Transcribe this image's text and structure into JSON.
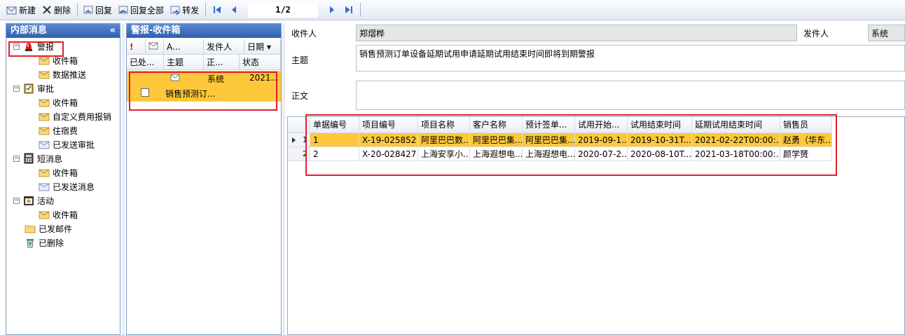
{
  "toolbar": {
    "new_label": "新建",
    "delete_label": "删除",
    "reply_label": "回复",
    "reply_all_label": "回复全部",
    "forward_label": "转发",
    "pager": "1/2"
  },
  "left": {
    "title": "内部消息",
    "collapse_glyph": "«",
    "tree": {
      "alarm": "警报",
      "alarm_inbox": "收件箱",
      "alarm_push": "数据推送",
      "approve": "审批",
      "approve_inbox": "收件箱",
      "approve_custom": "自定义费用报销",
      "approve_hotel": "住宿费",
      "approve_sent": "已发送审批",
      "sms": "短消息",
      "sms_inbox": "收件箱",
      "sms_sent": "已发送消息",
      "activity": "活动",
      "activity_inbox": "收件箱",
      "sent_mail": "已发邮件",
      "deleted": "已删除"
    }
  },
  "mid": {
    "title": "警报-收件箱",
    "headers": {
      "flag": "!",
      "att": "A...",
      "sender": "发件人",
      "date": "日期 ▾",
      "processed": "已处...",
      "subject": "主题",
      "body": "正...",
      "status": "状态"
    },
    "row": {
      "sender": "系统",
      "date": "2021...",
      "subject": "销售预测订..."
    }
  },
  "detail": {
    "recipient_label": "收件人",
    "recipient": "郑熠桦",
    "sender_label": "发件人",
    "sender": "系统",
    "subject_label": "主题",
    "subject": "销售预测订单设备延期试用申请延期试用结束时间即将到期警报",
    "body_label": "正文",
    "body": ""
  },
  "grid": {
    "headers": [
      "单据编号",
      "项目编号",
      "项目名称",
      "客户名称",
      "预计签单...",
      "试用开始...",
      "试用结束时间",
      "延期试用结束时间",
      "销售员"
    ],
    "rows": [
      {
        "rownum": "1",
        "cells": [
          "1",
          "X-19-025852",
          "阿里巴巴数...",
          "阿里巴巴集...",
          "阿里巴巴集...",
          "2019-09-1...",
          "2019-10-31T...",
          "2021-02-22T00:00:...",
          "赵勇（华东..."
        ]
      },
      {
        "rownum": "2",
        "cells": [
          "2",
          "X-20-028427",
          "上海安享小...",
          "上海遐想电...",
          "上海遐想电...",
          "2020-07-2...",
          "2020-08-10T...",
          "2021-03-18T00:00:...",
          "颜学赟"
        ]
      }
    ]
  },
  "colors": {
    "selected_row": "#fdc93a",
    "panel_header": "#2f5fae",
    "highlight_box": "#e0202a"
  }
}
